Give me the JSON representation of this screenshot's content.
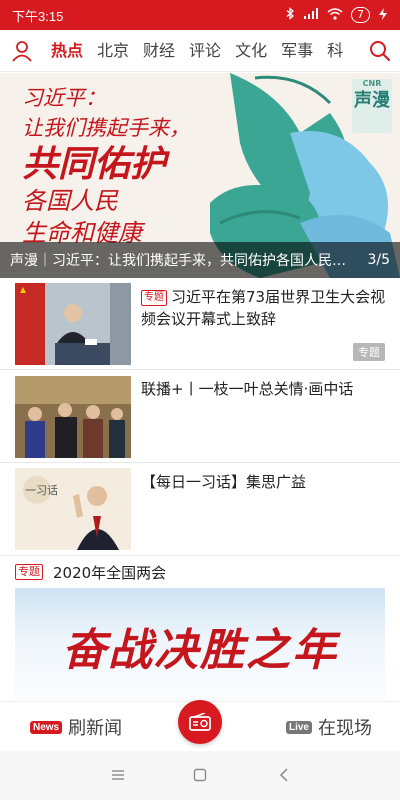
{
  "status_bar": {
    "time": "下午3:15",
    "battery": "7"
  },
  "header": {
    "tabs": [
      {
        "label": "热点",
        "active": true
      },
      {
        "label": "北京",
        "active": false
      },
      {
        "label": "财经",
        "active": false
      },
      {
        "label": "评论",
        "active": false
      },
      {
        "label": "文化",
        "active": false
      },
      {
        "label": "军事",
        "active": false
      },
      {
        "label": "科",
        "active": false
      }
    ]
  },
  "hero": {
    "lines": [
      "习近平：",
      "让我们携起手来，",
      "共同佑护",
      "各国人民",
      "生命和健康"
    ],
    "logo_text": "声漫",
    "logo_small": "CNR",
    "caption": "声漫｜习近平：让我们携起手来，共同佑护各国人民生命和健康",
    "counter": "3/5"
  },
  "news": [
    {
      "tag": "专题",
      "title": "习近平在第73届世界卫生大会视频会议开幕式上致辞",
      "badge": "专题"
    },
    {
      "title": "联播+丨一枝一叶总关情·画中话"
    },
    {
      "title": "【每日一习话】集思广益"
    }
  ],
  "topic": {
    "tag": "专题",
    "title": "2020年全国两会",
    "banner_text": "奋战决胜之年"
  },
  "bottom_nav": {
    "news_badge": "News",
    "news_label": "刷新闻",
    "live_badge": "Live",
    "live_label": "在现场"
  },
  "colors": {
    "brand_red": "#d71920"
  }
}
